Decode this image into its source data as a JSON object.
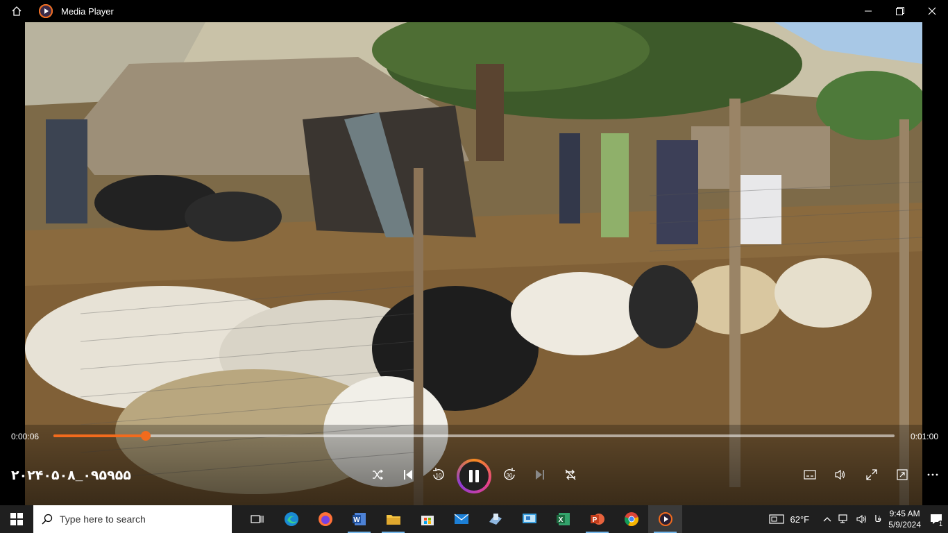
{
  "window": {
    "title": "Media Player",
    "icons": [
      "home-icon",
      "media-player-icon",
      "minimize-icon",
      "maximize-icon",
      "close-icon"
    ]
  },
  "player": {
    "current_time": "0:00:06",
    "total_time": "0:01:00",
    "progress_fraction": 0.11,
    "filename": "۲۰۲۴۰۵۰۸_۰۹۵۹۵۵",
    "accent_color": "#f26b1d",
    "controls": [
      "shuffle-icon",
      "previous-icon",
      "skip-back-10-icon",
      "pause-icon",
      "skip-forward-30-icon",
      "next-icon",
      "repeat-off-icon",
      "captions-icon",
      "volume-icon",
      "fullscreen-icon",
      "mini-player-icon",
      "more-icon"
    ],
    "skip_back_label": "10",
    "skip_forward_label": "30"
  },
  "taskbar": {
    "search_placeholder": "Type here to search",
    "apps": [
      "task-view-icon",
      "edge-icon",
      "firefox-icon",
      "word-icon",
      "file-explorer-icon",
      "store-icon",
      "mail-icon",
      "desktop-app-icon",
      "control-panel-icon",
      "excel-icon",
      "powerpoint-icon",
      "chrome-icon",
      "media-player-icon"
    ],
    "weather": "62°F",
    "language": "فا",
    "time": "9:45 AM",
    "date": "5/9/2024",
    "notification_count": "1"
  }
}
